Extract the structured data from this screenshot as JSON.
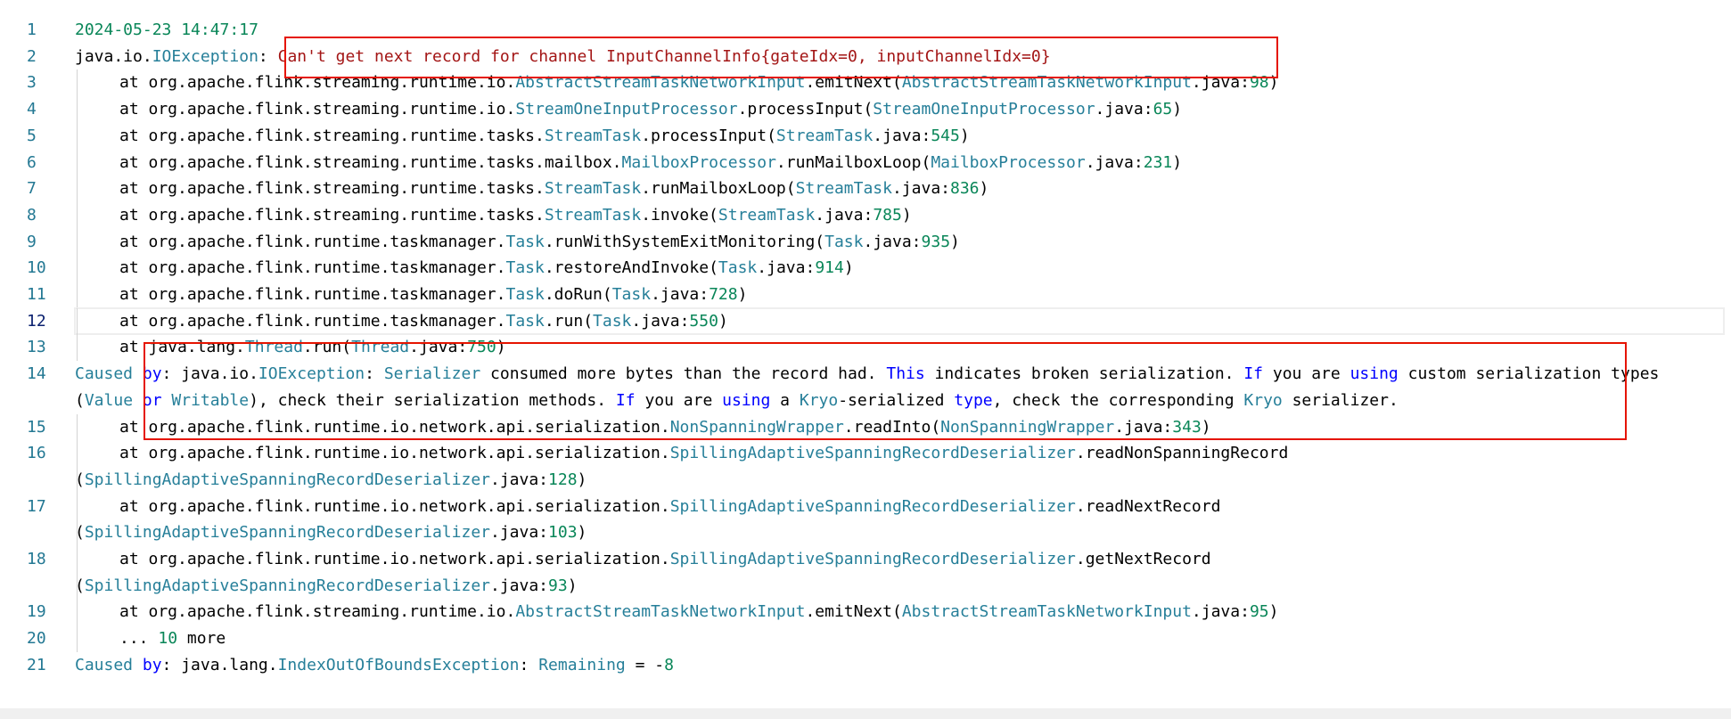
{
  "lines": [
    {
      "n": "1",
      "indent": false,
      "tokens": [
        {
          "t": "2024-05-23 14:47:17",
          "c": "date"
        }
      ]
    },
    {
      "n": "2",
      "indent": false,
      "tokens": [
        {
          "t": "java.io.",
          "c": "plain"
        },
        {
          "t": "IOException",
          "c": "cls"
        },
        {
          "t": ": ",
          "c": "plain"
        },
        {
          "t": "Can't get next record for channel InputChannelInfo{gateIdx=0, inputChannelIdx=0}",
          "c": "msg"
        }
      ]
    },
    {
      "n": "3",
      "indent": true,
      "tokens": [
        {
          "t": "at org.apache.flink.streaming.runtime.io.",
          "c": "plain"
        },
        {
          "t": "AbstractStreamTaskNetworkInput",
          "c": "cls"
        },
        {
          "t": ".emitNext(",
          "c": "plain"
        },
        {
          "t": "AbstractStreamTaskNetworkInput",
          "c": "cls"
        },
        {
          "t": ".java:",
          "c": "plain"
        },
        {
          "t": "98",
          "c": "num"
        },
        {
          "t": ")",
          "c": "plain"
        }
      ]
    },
    {
      "n": "4",
      "indent": true,
      "tokens": [
        {
          "t": "at org.apache.flink.streaming.runtime.io.",
          "c": "plain"
        },
        {
          "t": "StreamOneInputProcessor",
          "c": "cls"
        },
        {
          "t": ".processInput(",
          "c": "plain"
        },
        {
          "t": "StreamOneInputProcessor",
          "c": "cls"
        },
        {
          "t": ".java:",
          "c": "plain"
        },
        {
          "t": "65",
          "c": "num"
        },
        {
          "t": ")",
          "c": "plain"
        }
      ]
    },
    {
      "n": "5",
      "indent": true,
      "tokens": [
        {
          "t": "at org.apache.flink.streaming.runtime.tasks.",
          "c": "plain"
        },
        {
          "t": "StreamTask",
          "c": "cls"
        },
        {
          "t": ".processInput(",
          "c": "plain"
        },
        {
          "t": "StreamTask",
          "c": "cls"
        },
        {
          "t": ".java:",
          "c": "plain"
        },
        {
          "t": "545",
          "c": "num"
        },
        {
          "t": ")",
          "c": "plain"
        }
      ]
    },
    {
      "n": "6",
      "indent": true,
      "tokens": [
        {
          "t": "at org.apache.flink.streaming.runtime.tasks.mailbox.",
          "c": "plain"
        },
        {
          "t": "MailboxProcessor",
          "c": "cls"
        },
        {
          "t": ".runMailboxLoop(",
          "c": "plain"
        },
        {
          "t": "MailboxProcessor",
          "c": "cls"
        },
        {
          "t": ".java:",
          "c": "plain"
        },
        {
          "t": "231",
          "c": "num"
        },
        {
          "t": ")",
          "c": "plain"
        }
      ]
    },
    {
      "n": "7",
      "indent": true,
      "tokens": [
        {
          "t": "at org.apache.flink.streaming.runtime.tasks.",
          "c": "plain"
        },
        {
          "t": "StreamTask",
          "c": "cls"
        },
        {
          "t": ".runMailboxLoop(",
          "c": "plain"
        },
        {
          "t": "StreamTask",
          "c": "cls"
        },
        {
          "t": ".java:",
          "c": "plain"
        },
        {
          "t": "836",
          "c": "num"
        },
        {
          "t": ")",
          "c": "plain"
        }
      ]
    },
    {
      "n": "8",
      "indent": true,
      "tokens": [
        {
          "t": "at org.apache.flink.streaming.runtime.tasks.",
          "c": "plain"
        },
        {
          "t": "StreamTask",
          "c": "cls"
        },
        {
          "t": ".invoke(",
          "c": "plain"
        },
        {
          "t": "StreamTask",
          "c": "cls"
        },
        {
          "t": ".java:",
          "c": "plain"
        },
        {
          "t": "785",
          "c": "num"
        },
        {
          "t": ")",
          "c": "plain"
        }
      ]
    },
    {
      "n": "9",
      "indent": true,
      "tokens": [
        {
          "t": "at org.apache.flink.runtime.taskmanager.",
          "c": "plain"
        },
        {
          "t": "Task",
          "c": "cls"
        },
        {
          "t": ".runWithSystemExitMonitoring(",
          "c": "plain"
        },
        {
          "t": "Task",
          "c": "cls"
        },
        {
          "t": ".java:",
          "c": "plain"
        },
        {
          "t": "935",
          "c": "num"
        },
        {
          "t": ")",
          "c": "plain"
        }
      ]
    },
    {
      "n": "10",
      "indent": true,
      "tokens": [
        {
          "t": "at org.apache.flink.runtime.taskmanager.",
          "c": "plain"
        },
        {
          "t": "Task",
          "c": "cls"
        },
        {
          "t": ".restoreAndInvoke(",
          "c": "plain"
        },
        {
          "t": "Task",
          "c": "cls"
        },
        {
          "t": ".java:",
          "c": "plain"
        },
        {
          "t": "914",
          "c": "num"
        },
        {
          "t": ")",
          "c": "plain"
        }
      ]
    },
    {
      "n": "11",
      "indent": true,
      "tokens": [
        {
          "t": "at org.apache.flink.runtime.taskmanager.",
          "c": "plain"
        },
        {
          "t": "Task",
          "c": "cls"
        },
        {
          "t": ".doRun(",
          "c": "plain"
        },
        {
          "t": "Task",
          "c": "cls"
        },
        {
          "t": ".java:",
          "c": "plain"
        },
        {
          "t": "728",
          "c": "num"
        },
        {
          "t": ")",
          "c": "plain"
        }
      ]
    },
    {
      "n": "12",
      "indent": true,
      "current": true,
      "tokens": [
        {
          "t": "at org.apache.flink.runtime.taskmanager.",
          "c": "plain"
        },
        {
          "t": "Task",
          "c": "cls"
        },
        {
          "t": ".run(",
          "c": "plain"
        },
        {
          "t": "Task",
          "c": "cls"
        },
        {
          "t": ".java:",
          "c": "plain"
        },
        {
          "t": "550",
          "c": "num"
        },
        {
          "t": ")",
          "c": "plain"
        }
      ]
    },
    {
      "n": "13",
      "indent": true,
      "tokens": [
        {
          "t": "at java.lang.",
          "c": "plain"
        },
        {
          "t": "Thread",
          "c": "cls"
        },
        {
          "t": ".run(",
          "c": "plain"
        },
        {
          "t": "Thread",
          "c": "cls"
        },
        {
          "t": ".java:",
          "c": "plain"
        },
        {
          "t": "750",
          "c": "num"
        },
        {
          "t": ")",
          "c": "plain"
        }
      ]
    },
    {
      "n": "14",
      "indent": false,
      "tokens": [
        {
          "t": "Caused ",
          "c": "cls"
        },
        {
          "t": "by",
          "c": "kw"
        },
        {
          "t": ": java.io.",
          "c": "plain"
        },
        {
          "t": "IOException",
          "c": "cls"
        },
        {
          "t": ": ",
          "c": "plain"
        },
        {
          "t": "Serializer",
          "c": "cls"
        },
        {
          "t": " consumed more bytes than the record had. ",
          "c": "plain"
        },
        {
          "t": "This",
          "c": "kw"
        },
        {
          "t": " indicates broken serialization. ",
          "c": "plain"
        },
        {
          "t": "If",
          "c": "kw"
        },
        {
          "t": " you are ",
          "c": "plain"
        },
        {
          "t": "using",
          "c": "kw"
        },
        {
          "t": " custom serialization types (",
          "c": "plain"
        },
        {
          "t": "Value",
          "c": "cls"
        },
        {
          "t": " ",
          "c": "plain"
        },
        {
          "t": "or",
          "c": "kw"
        },
        {
          "t": " ",
          "c": "plain"
        },
        {
          "t": "Writable",
          "c": "cls"
        },
        {
          "t": "), check their serialization methods. ",
          "c": "plain"
        },
        {
          "t": "If",
          "c": "kw"
        },
        {
          "t": " you are ",
          "c": "plain"
        },
        {
          "t": "using",
          "c": "kw"
        },
        {
          "t": " a ",
          "c": "plain"
        },
        {
          "t": "Kryo",
          "c": "cls"
        },
        {
          "t": "-serialized ",
          "c": "plain"
        },
        {
          "t": "type",
          "c": "kw"
        },
        {
          "t": ", check the corresponding ",
          "c": "plain"
        },
        {
          "t": "Kryo",
          "c": "cls"
        },
        {
          "t": " serializer.",
          "c": "plain"
        }
      ]
    },
    {
      "n": "15",
      "indent": true,
      "tokens": [
        {
          "t": "at org.apache.flink.runtime.io.network.api.serialization.",
          "c": "plain"
        },
        {
          "t": "NonSpanningWrapper",
          "c": "cls"
        },
        {
          "t": ".readInto(",
          "c": "plain"
        },
        {
          "t": "NonSpanningWrapper",
          "c": "cls"
        },
        {
          "t": ".java:",
          "c": "plain"
        },
        {
          "t": "343",
          "c": "num"
        },
        {
          "t": ")",
          "c": "plain"
        }
      ]
    },
    {
      "n": "16",
      "indent": true,
      "wrap": true,
      "tokens": [
        {
          "t": "at org.apache.flink.runtime.io.network.api.serialization.",
          "c": "plain"
        },
        {
          "t": "SpillingAdaptiveSpanningRecordDeserializer",
          "c": "cls"
        },
        {
          "t": ".readNonSpanningRecord",
          "c": "plain"
        }
      ],
      "tokens2": [
        {
          "t": "(",
          "c": "plain"
        },
        {
          "t": "SpillingAdaptiveSpanningRecordDeserializer",
          "c": "cls"
        },
        {
          "t": ".java:",
          "c": "plain"
        },
        {
          "t": "128",
          "c": "num"
        },
        {
          "t": ")",
          "c": "plain"
        }
      ]
    },
    {
      "n": "17",
      "indent": true,
      "wrap": true,
      "tokens": [
        {
          "t": "at org.apache.flink.runtime.io.network.api.serialization.",
          "c": "plain"
        },
        {
          "t": "SpillingAdaptiveSpanningRecordDeserializer",
          "c": "cls"
        },
        {
          "t": ".readNextRecord",
          "c": "plain"
        }
      ],
      "tokens2": [
        {
          "t": "(",
          "c": "plain"
        },
        {
          "t": "SpillingAdaptiveSpanningRecordDeserializer",
          "c": "cls"
        },
        {
          "t": ".java:",
          "c": "plain"
        },
        {
          "t": "103",
          "c": "num"
        },
        {
          "t": ")",
          "c": "plain"
        }
      ]
    },
    {
      "n": "18",
      "indent": true,
      "wrap": true,
      "tokens": [
        {
          "t": "at org.apache.flink.runtime.io.network.api.serialization.",
          "c": "plain"
        },
        {
          "t": "SpillingAdaptiveSpanningRecordDeserializer",
          "c": "cls"
        },
        {
          "t": ".getNextRecord",
          "c": "plain"
        }
      ],
      "tokens2": [
        {
          "t": "(",
          "c": "plain"
        },
        {
          "t": "SpillingAdaptiveSpanningRecordDeserializer",
          "c": "cls"
        },
        {
          "t": ".java:",
          "c": "plain"
        },
        {
          "t": "93",
          "c": "num"
        },
        {
          "t": ")",
          "c": "plain"
        }
      ]
    },
    {
      "n": "19",
      "indent": true,
      "tokens": [
        {
          "t": "at org.apache.flink.streaming.runtime.io.",
          "c": "plain"
        },
        {
          "t": "AbstractStreamTaskNetworkInput",
          "c": "cls"
        },
        {
          "t": ".emitNext(",
          "c": "plain"
        },
        {
          "t": "AbstractStreamTaskNetworkInput",
          "c": "cls"
        },
        {
          "t": ".java:",
          "c": "plain"
        },
        {
          "t": "95",
          "c": "num"
        },
        {
          "t": ")",
          "c": "plain"
        }
      ]
    },
    {
      "n": "20",
      "indent": true,
      "tokens": [
        {
          "t": "... ",
          "c": "plain"
        },
        {
          "t": "10",
          "c": "num"
        },
        {
          "t": " more",
          "c": "plain"
        }
      ]
    },
    {
      "n": "21",
      "indent": false,
      "tokens": [
        {
          "t": "Caused ",
          "c": "cls"
        },
        {
          "t": "by",
          "c": "kw"
        },
        {
          "t": ": java.lang.",
          "c": "plain"
        },
        {
          "t": "IndexOutOfBoundsException",
          "c": "cls"
        },
        {
          "t": ": ",
          "c": "plain"
        },
        {
          "t": "Remaining",
          "c": "cls"
        },
        {
          "t": " = -",
          "c": "plain"
        },
        {
          "t": "8",
          "c": "num"
        }
      ]
    }
  ],
  "colors": {
    "highlight_box": "#e51400",
    "line_number": "#237893",
    "active_line_number": "#0b216f"
  }
}
